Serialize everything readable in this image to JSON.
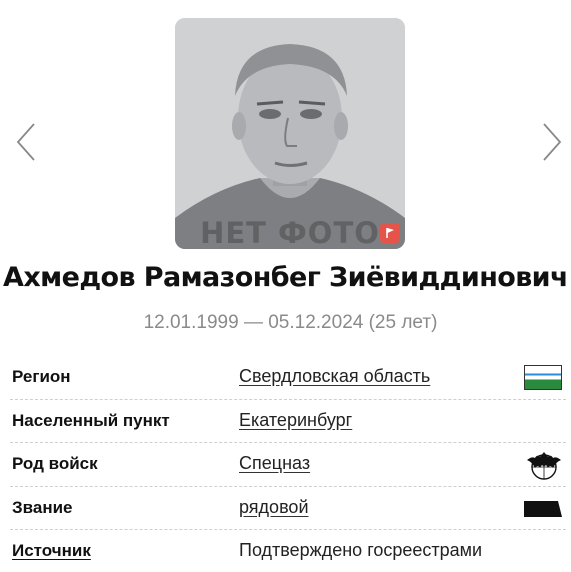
{
  "photo": {
    "placeholder_text": "НЕТ ФОТО",
    "icons": {
      "prev": "chevron-left-icon",
      "next": "chevron-right-icon",
      "flag": "flag-icon"
    },
    "colors": {
      "background": "#cfd1d3",
      "flag_button": "#e5534b"
    }
  },
  "person": {
    "full_name": "Ахмедов Рамазонбег Зиёвиддинович",
    "dates": "12.01.1999 — 05.12.2024 (25 лет)"
  },
  "details": [
    {
      "label": "Регион",
      "value": "Свердловская область",
      "icon": "sverdlovsk-flag-icon"
    },
    {
      "label": "Населенный пункт",
      "value": "Екатеринбург"
    },
    {
      "label": "Род войск",
      "value": "Спецназ",
      "icon": "spetsnaz-bat-emblem-icon"
    },
    {
      "label": "Звание",
      "value": "рядовой",
      "icon": "private-rank-insignia-icon"
    },
    {
      "label": "Источник",
      "value": "Подтверждено госреестрами"
    }
  ]
}
